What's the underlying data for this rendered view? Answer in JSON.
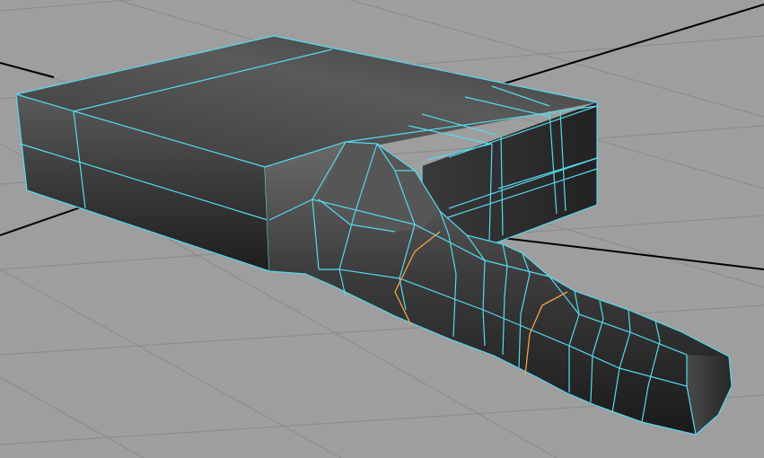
{
  "viewport": {
    "background": "#9e9e9e",
    "grid_color": "#8c8c8c",
    "axis_color": "#000000"
  },
  "model": {
    "wire_color": "#56d9ef",
    "selected_edge_color": "#f0a44a",
    "shade_dark": "#262626",
    "shade_mid": "#4a4a4a",
    "shade_light": "#6c6c6c"
  }
}
